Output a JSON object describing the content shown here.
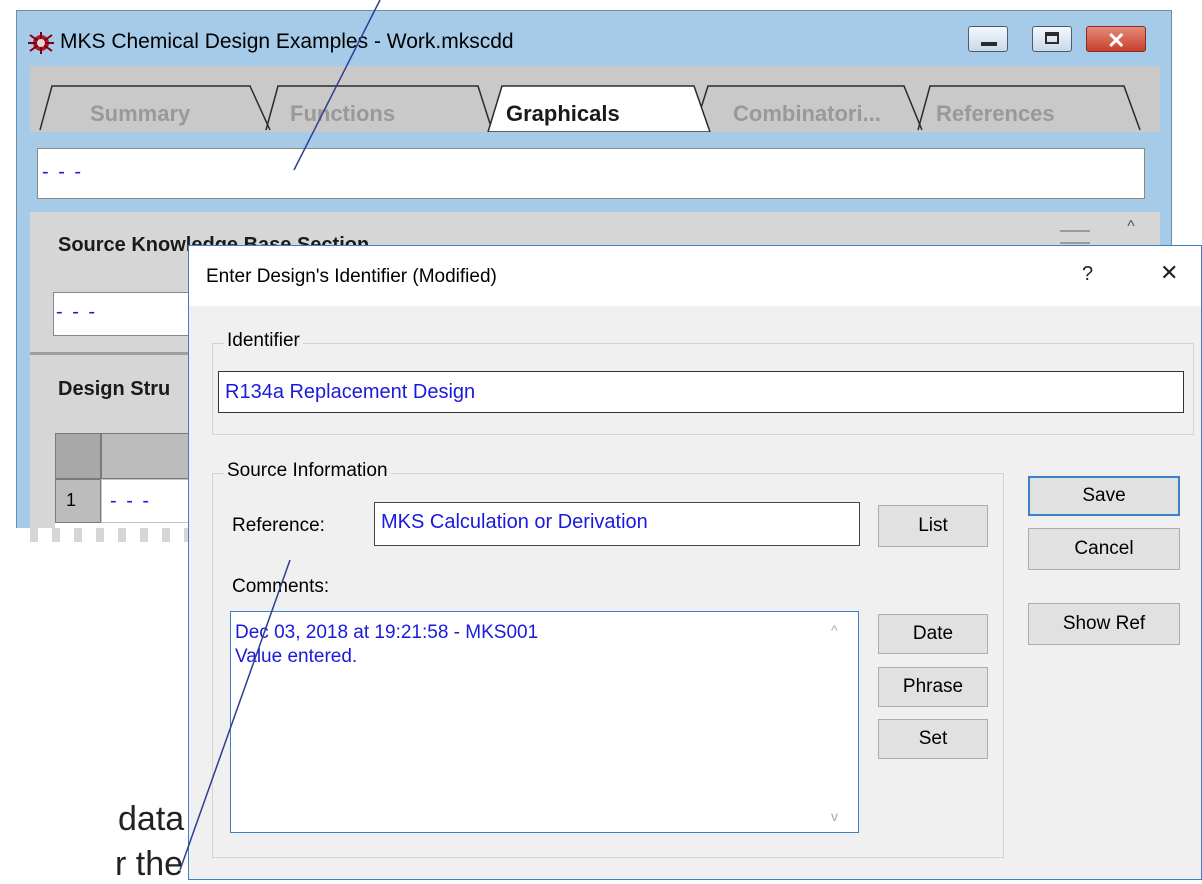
{
  "main_window": {
    "title": "MKS Chemical Design Examples - Work.mkscdd",
    "tabs": [
      "Summary",
      "Functions",
      "Graphicals",
      "Combinatori...",
      "References"
    ],
    "active_tab": "Graphicals",
    "identifier_value": "- - -",
    "section_source_kb": "Source Knowledge Base Section",
    "source_kb_value": "- - -",
    "section_design_structure": "Design Stru",
    "table": {
      "row_number": "1",
      "row_value": "- - -"
    }
  },
  "dialog": {
    "title": "Enter Design's Identifier (Modified)",
    "help_glyph": "?",
    "close_glyph": "✕",
    "identifier_group_label": "Identifier",
    "identifier_value": "R134a Replacement Design",
    "source_group_label": "Source Information",
    "reference_label": "Reference:",
    "reference_value": "MKS Calculation or Derivation",
    "list_button": "List",
    "comments_label": "Comments:",
    "comments_lines": [
      "Dec 03, 2018 at 19:21:58 - MKS001",
      "Value entered."
    ],
    "date_button": "Date",
    "phrase_button": "Phrase",
    "set_button": "Set",
    "save_button": "Save",
    "cancel_button": "Cancel",
    "show_ref_button": "Show Ref"
  },
  "background_text": {
    "line1": "data",
    "line2": "r the"
  },
  "colors": {
    "accent_blue": "#1a1adc",
    "title_bar": "#a5cbe8",
    "close_red": "#c7402d",
    "annotation_line": "#2e3f8f"
  }
}
